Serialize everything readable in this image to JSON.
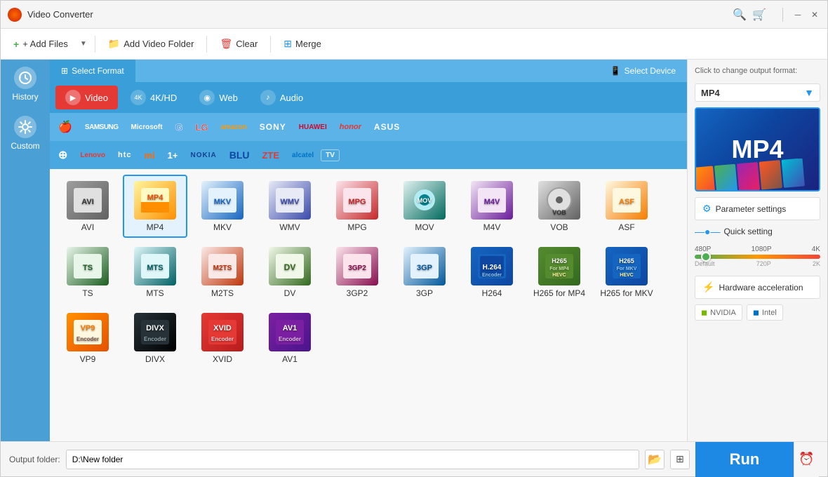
{
  "window": {
    "title": "Video Converter"
  },
  "toolbar": {
    "add_files": "+ Add Files",
    "add_video_folder": "Add Video Folder",
    "clear": "Clear",
    "merge": "Merge"
  },
  "sidebar": {
    "items": [
      {
        "label": "History",
        "icon": "⟳"
      },
      {
        "label": "Custom",
        "icon": "⚙"
      }
    ]
  },
  "format_panel": {
    "select_format_tab": "Select Format",
    "select_device_tab": "Select Device",
    "types": [
      {
        "label": "Video",
        "icon": "▶",
        "active": true
      },
      {
        "label": "4K/HD",
        "icon": "⊞"
      },
      {
        "label": "Web",
        "icon": "◉"
      },
      {
        "label": "Audio",
        "icon": "♪"
      }
    ],
    "brands_row1": [
      "🍎",
      "SAMSUNG",
      "Microsoft",
      "G",
      "LG",
      "amazon",
      "SONY",
      "HUAWEI",
      "honor",
      "ASUS"
    ],
    "brands_row2": [
      "Motorola",
      "Lenovo",
      "htc",
      "mi",
      "1+",
      "NOKIA",
      "BLU",
      "ZTE",
      "alcatel",
      "TV"
    ],
    "formats": [
      {
        "label": "AVI",
        "color1": "#9e9e9e",
        "color2": "#616161",
        "text": "AVI",
        "selected": false
      },
      {
        "label": "MP4",
        "color1": "#ffd54f",
        "color2": "#ff8f00",
        "text": "MP4",
        "selected": true
      },
      {
        "label": "MKV",
        "color1": "#90caf9",
        "color2": "#1565c0",
        "text": "MKV",
        "selected": false
      },
      {
        "label": "WMV",
        "color1": "#9fa8da",
        "color2": "#283593",
        "text": "WMV",
        "selected": false
      },
      {
        "label": "MPG",
        "color1": "#ef9a9a",
        "color2": "#b71c1c",
        "text": "MPG",
        "selected": false
      },
      {
        "label": "MOV",
        "color1": "#80cbc4",
        "color2": "#004d40",
        "text": "MOV",
        "selected": false
      },
      {
        "label": "M4V",
        "color1": "#ce93d8",
        "color2": "#4a148c",
        "text": "M4V",
        "selected": false
      },
      {
        "label": "VOB",
        "color1": "#b0bec5",
        "color2": "#263238",
        "text": "VOB",
        "selected": false
      },
      {
        "label": "ASF",
        "color1": "#ffe082",
        "color2": "#e65100",
        "text": "ASF",
        "selected": false
      },
      {
        "label": "TS",
        "color1": "#a5d6a7",
        "color2": "#1b5e20",
        "text": "TS",
        "selected": false
      },
      {
        "label": "MTS",
        "color1": "#80deea",
        "color2": "#006064",
        "text": "MTS",
        "selected": false
      },
      {
        "label": "M2TS",
        "color1": "#ffcc80",
        "color2": "#bf360c",
        "text": "M2TS",
        "selected": false
      },
      {
        "label": "DV",
        "color1": "#c5e1a5",
        "color2": "#33691e",
        "text": "DV",
        "selected": false
      },
      {
        "label": "3GP2",
        "color1": "#f8bbd9",
        "color2": "#880e4f",
        "text": "3GP2",
        "selected": false
      },
      {
        "label": "3GP",
        "color1": "#b3e5fc",
        "color2": "#01579b",
        "text": "3GP",
        "selected": false
      },
      {
        "label": "H264",
        "color1": "#1565c0",
        "color2": "#0d47a1",
        "text": "H.264",
        "selected": false
      },
      {
        "label": "H265 for MP4",
        "color1": "#558b2f",
        "color2": "#33691e",
        "text": "H265 MP4",
        "selected": false
      },
      {
        "label": "H265 for MKV",
        "color1": "#1565c0",
        "color2": "#0d47a1",
        "text": "H265 MKV",
        "selected": false
      },
      {
        "label": "VP9",
        "color1": "#f57c00",
        "color2": "#e65100",
        "text": "VP9",
        "selected": false
      },
      {
        "label": "DIVX",
        "color1": "#263238",
        "color2": "#000000",
        "text": "DIVX",
        "selected": false
      },
      {
        "label": "XVID",
        "color1": "#e53935",
        "color2": "#b71c1c",
        "text": "XVID",
        "selected": false
      },
      {
        "label": "AV1",
        "color1": "#6a1b9a",
        "color2": "#4a148c",
        "text": "AV1",
        "selected": false
      }
    ]
  },
  "right_panel": {
    "click_to_change": "Click to change output format:",
    "output_format": "MP4",
    "param_settings": "Parameter settings",
    "quick_setting": "Quick setting",
    "quality_labels": [
      "480P",
      "1080P",
      "4K"
    ],
    "quality_sublabels": [
      "Default",
      "720P",
      "2K"
    ],
    "hw_acceleration": "Hardware acceleration",
    "nvidia_label": "NVIDIA",
    "intel_label": "Intel"
  },
  "bottom": {
    "output_label": "Output folder:",
    "output_path": "D:\\New folder",
    "run_label": "Run"
  }
}
